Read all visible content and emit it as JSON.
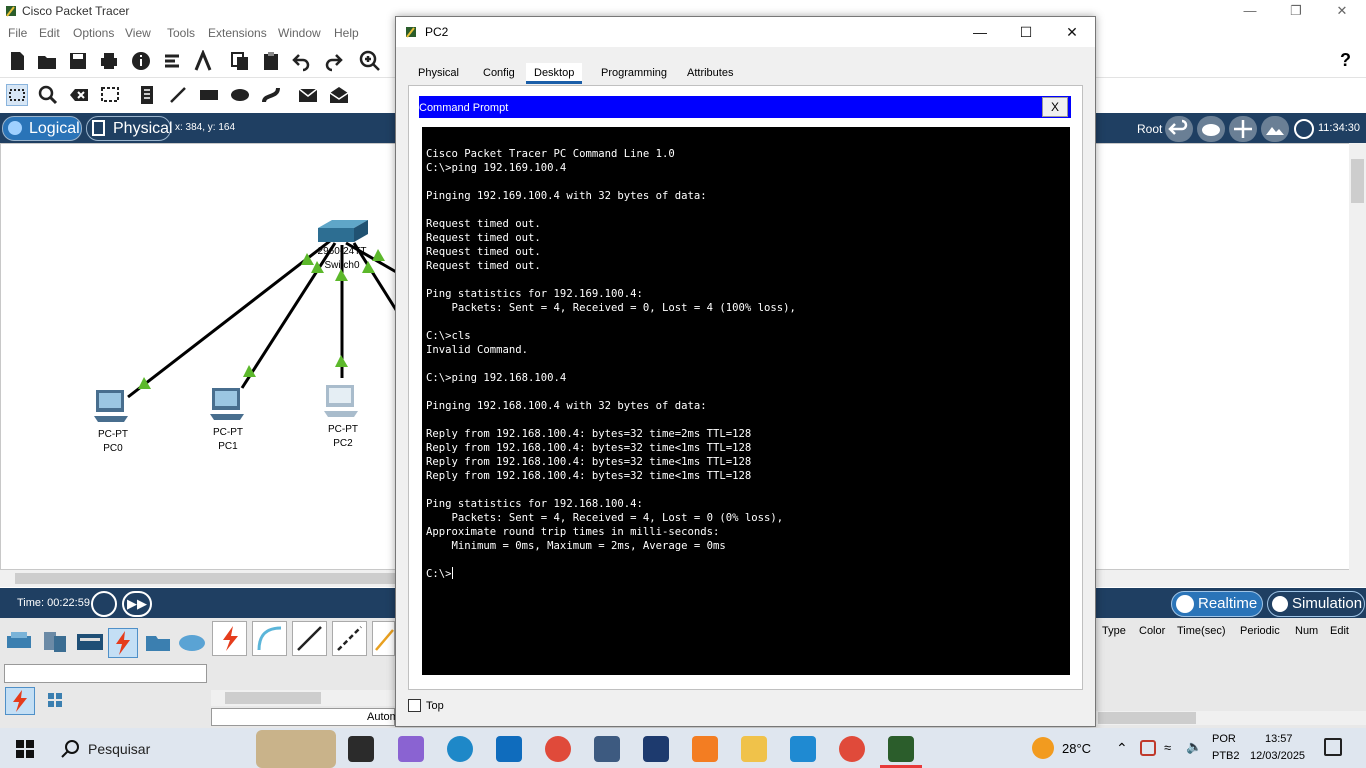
{
  "app": {
    "title": "Cisco Packet Tracer",
    "menu": [
      "File",
      "Edit",
      "Options",
      "View",
      "Tools",
      "Extensions",
      "Window",
      "Help"
    ],
    "help_icon": "?",
    "modes": {
      "logical": "Logical",
      "physical": "Physical"
    },
    "coords": "x: 384, y: 164",
    "root": "Root",
    "clock": "11:34:30",
    "time": "Time: 00:22:59",
    "realtime": "Realtime",
    "simulation": "Simulation",
    "pdu_columns": [
      "Type",
      "Color",
      "Time(sec)",
      "Periodic",
      "Num",
      "Edit"
    ],
    "auto_label": "Autom"
  },
  "topology": {
    "switch": {
      "model": "2960-24TT",
      "name": "Switch0"
    },
    "pcs": [
      {
        "type": "PC-PT",
        "name": "PC0"
      },
      {
        "type": "PC-PT",
        "name": "PC1"
      },
      {
        "type": "PC-PT",
        "name": "PC2"
      }
    ],
    "colors": {
      "link": "#000000",
      "port_up": "#5cb82b"
    }
  },
  "dialog": {
    "title": "PC2",
    "tabs": [
      "Physical",
      "Config",
      "Desktop",
      "Programming",
      "Attributes"
    ],
    "active_tab": "Desktop",
    "cmd_title": "Command Prompt",
    "cmd_close": "X",
    "top_label": "Top",
    "terminal_lines": [
      "Cisco Packet Tracer PC Command Line 1.0",
      "C:\\>ping 192.169.100.4",
      "",
      "Pinging 192.169.100.4 with 32 bytes of data:",
      "",
      "Request timed out.",
      "Request timed out.",
      "Request timed out.",
      "Request timed out.",
      "",
      "Ping statistics for 192.169.100.4:",
      "    Packets: Sent = 4, Received = 0, Lost = 4 (100% loss),",
      "",
      "C:\\>cls",
      "Invalid Command.",
      "",
      "C:\\>ping 192.168.100.4",
      "",
      "Pinging 192.168.100.4 with 32 bytes of data:",
      "",
      "Reply from 192.168.100.4: bytes=32 time=2ms TTL=128",
      "Reply from 192.168.100.4: bytes=32 time<1ms TTL=128",
      "Reply from 192.168.100.4: bytes=32 time<1ms TTL=128",
      "Reply from 192.168.100.4: bytes=32 time<1ms TTL=128",
      "",
      "Ping statistics for 192.168.100.4:",
      "    Packets: Sent = 4, Received = 4, Lost = 0 (0% loss),",
      "Approximate round trip times in milli-seconds:",
      "    Minimum = 0ms, Maximum = 2ms, Average = 0ms",
      ""
    ],
    "prompt": "C:\\>"
  },
  "taskbar": {
    "search": "Pesquisar",
    "weather": "28°C",
    "lang1": "POR",
    "lang2": "PTB2",
    "time": "13:57",
    "date": "12/03/2025"
  }
}
